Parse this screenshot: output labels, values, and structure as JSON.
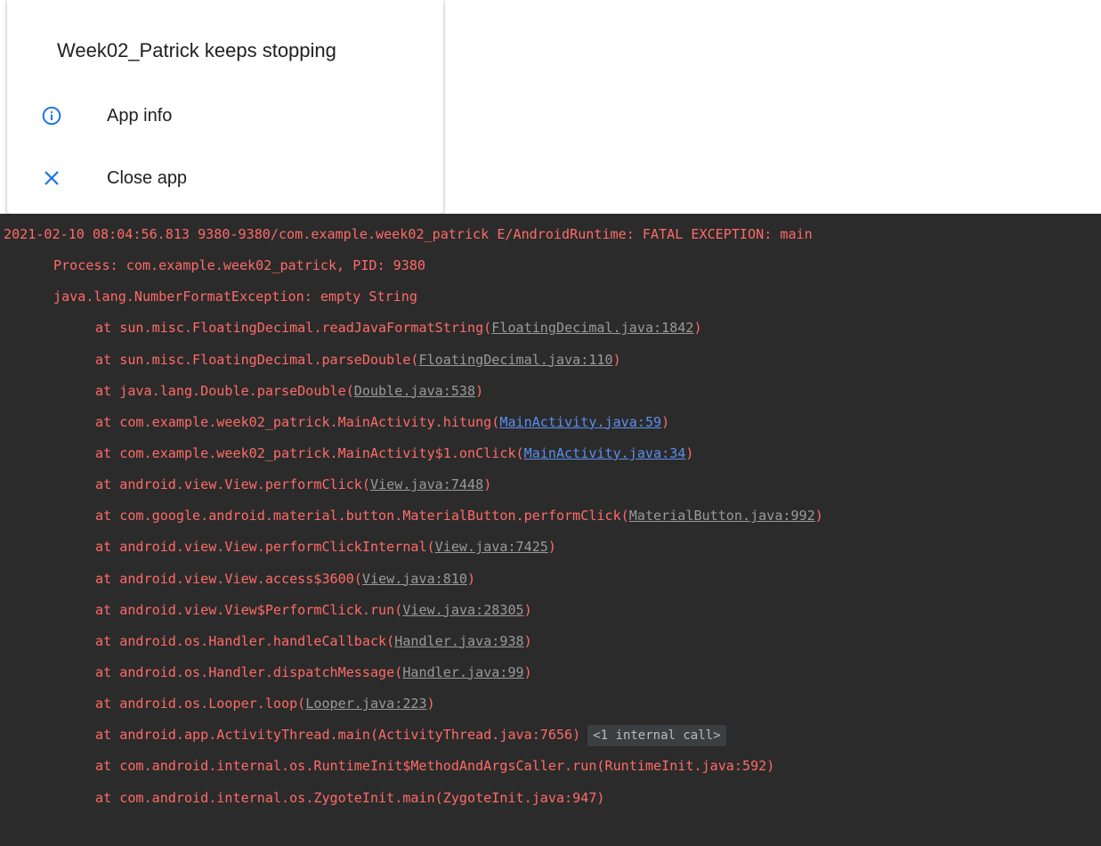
{
  "dialog": {
    "title": "Week02_Patrick keeps stopping",
    "app_info_label": "App info",
    "close_app_label": "Close app",
    "icon_color": "#1a73e8"
  },
  "logcat": {
    "header": "2021-02-10 08:04:56.813 9380-9380/com.example.week02_patrick E/AndroidRuntime: FATAL EXCEPTION: main",
    "process": "Process: com.example.week02_patrick, PID: 9380",
    "exception": "java.lang.NumberFormatException: empty String",
    "frames": [
      {
        "method": "at sun.misc.FloatingDecimal.readJavaFormatString(",
        "link": "FloatingDecimal.java:1842",
        "link_style": "gray",
        "tail": ")"
      },
      {
        "method": "at sun.misc.FloatingDecimal.parseDouble(",
        "link": "FloatingDecimal.java:110",
        "link_style": "gray",
        "tail": ")"
      },
      {
        "method": "at java.lang.Double.parseDouble(",
        "link": "Double.java:538",
        "link_style": "gray",
        "tail": ")"
      },
      {
        "method": "at com.example.week02_patrick.MainActivity.hitung(",
        "link": "MainActivity.java:59",
        "link_style": "blue",
        "tail": ")"
      },
      {
        "method": "at com.example.week02_patrick.MainActivity$1.onClick(",
        "link": "MainActivity.java:34",
        "link_style": "blue",
        "tail": ")"
      },
      {
        "method": "at android.view.View.performClick(",
        "link": "View.java:7448",
        "link_style": "gray",
        "tail": ")"
      },
      {
        "method": "at com.google.android.material.button.MaterialButton.performClick(",
        "link": "MaterialButton.java:992",
        "link_style": "gray",
        "tail": ")"
      },
      {
        "method": "at android.view.View.performClickInternal(",
        "link": "View.java:7425",
        "link_style": "gray",
        "tail": ")"
      },
      {
        "method": "at android.view.View.access$3600(",
        "link": "View.java:810",
        "link_style": "gray",
        "tail": ")"
      },
      {
        "method": "at android.view.View$PerformClick.run(",
        "link": "View.java:28305",
        "link_style": "gray",
        "tail": ")"
      },
      {
        "method": "at android.os.Handler.handleCallback(",
        "link": "Handler.java:938",
        "link_style": "gray",
        "tail": ")"
      },
      {
        "method": "at android.os.Handler.dispatchMessage(",
        "link": "Handler.java:99",
        "link_style": "gray",
        "tail": ")"
      },
      {
        "method": "at android.os.Looper.loop(",
        "link": "Looper.java:223",
        "link_style": "gray",
        "tail": ")"
      },
      {
        "method": "at android.app.ActivityThread.main(ActivityThread.java:7656)",
        "badge": "<1 internal call>"
      },
      {
        "method": "at com.android.internal.os.RuntimeInit$MethodAndArgsCaller.run(RuntimeInit.java:592)"
      },
      {
        "method": "at com.android.internal.os.ZygoteInit.main(ZygoteInit.java:947)"
      }
    ],
    "colors": {
      "background": "#2b2b2b",
      "error_text": "#ff6b68",
      "link_gray": "#9a9a9a",
      "link_blue": "#5b8ff0"
    }
  }
}
